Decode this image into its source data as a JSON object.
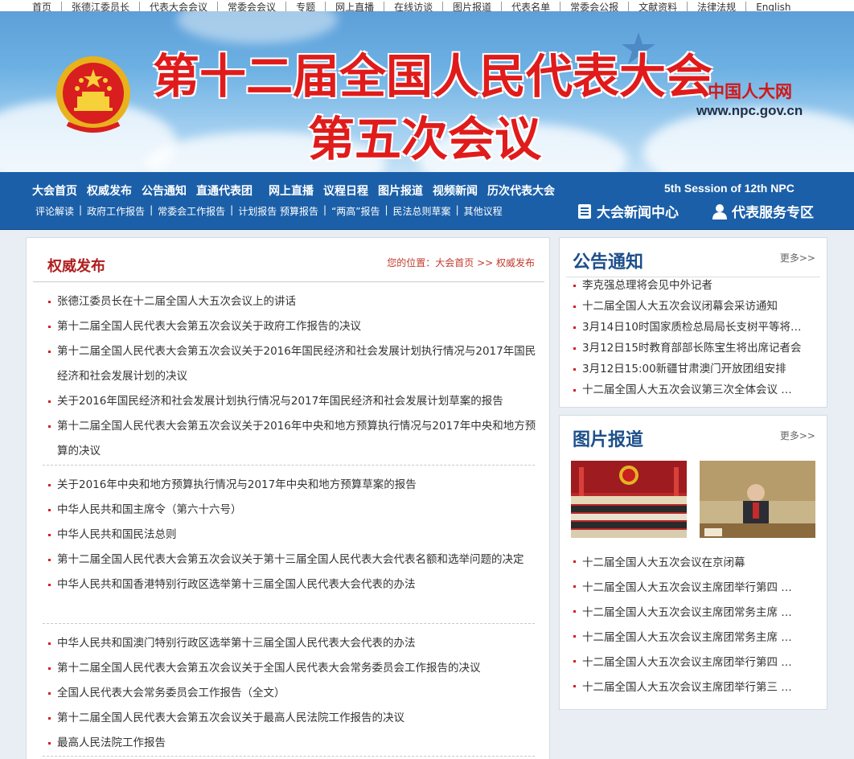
{
  "topnav": [
    "首页",
    "张德江委员长",
    "代表大会会议",
    "常委会会议",
    "专题",
    "网上直播",
    "在线访谈",
    "图片报道",
    "代表名单",
    "常委会公报",
    "文献资料",
    "法律法规",
    "English"
  ],
  "banner": {
    "title_line1": "第十二届全国人民代表大会",
    "title_line2": "第五次会议",
    "site_name": "中国人大网",
    "site_url": "www.npc.gov.cn"
  },
  "mainnav": [
    "大会首页",
    "权威发布",
    "公告通知",
    "直通代表团",
    "网上直播",
    "议程日程",
    "图片报道",
    "视频新闻",
    "历次代表大会"
  ],
  "subnav": [
    "评论解读",
    "政府工作报告",
    "常委会工作报告",
    "计划报告 预算报告",
    "“两高”报告",
    "民法总则草案",
    "其他议程"
  ],
  "session_en": "5th Session of 12th NPC",
  "services": {
    "news_center": "大会新闻中心",
    "deputy_service": "代表服务专区"
  },
  "left_panel": {
    "title": "权威发布",
    "breadcrumb": "您的位置：大会首页 >> 权威发布",
    "groups": [
      [
        "张德江委员长在十二届全国人大五次会议上的讲话",
        "第十二届全国人民代表大会第五次会议关于政府工作报告的决议",
        "第十二届全国人民代表大会第五次会议关于2016年国民经济和社会发展计划执行情况与2017年国民经济和社会发展计划的决议",
        "关于2016年国民经济和社会发展计划执行情况与2017年国民经济和社会发展计划草案的报告",
        "第十二届全国人民代表大会第五次会议关于2016年中央和地方预算执行情况与2017年中央和地方预算的决议"
      ],
      [
        "关于2016年中央和地方预算执行情况与2017年中央和地方预算草案的报告",
        "中华人民共和国主席令（第六十六号）",
        "中华人民共和国民法总则",
        "第十二届全国人民代表大会第五次会议关于第十三届全国人民代表大会代表名额和选举问题的决定",
        "中华人民共和国香港特别行政区选举第十三届全国人民代表大会代表的办法"
      ],
      [
        "中华人民共和国澳门特别行政区选举第十三届全国人民代表大会代表的办法",
        "第十二届全国人民代表大会第五次会议关于全国人民代表大会常务委员会工作报告的决议",
        "全国人民代表大会常务委员会工作报告（全文）",
        "第十二届全国人民代表大会第五次会议关于最高人民法院工作报告的决议",
        "最高人民法院工作报告"
      ]
    ]
  },
  "notice_panel": {
    "title": "公告通知",
    "more": "更多>>",
    "items": [
      "李克强总理将会见中外记者",
      "十二届全国人大五次会议闭幕会采访通知",
      "3月14日10时国家质检总局局长支树平等将…",
      "3月12日15时教育部部长陈宝生将出席记者会",
      "3月12日15:00新疆甘肃澳门开放团组安排",
      "十二届全国人大五次会议第三次全体会议 …"
    ]
  },
  "photo_panel": {
    "title": "图片报道",
    "more": "更多>>",
    "items": [
      "十二届全国人大五次会议在京闭幕",
      "十二届全国人大五次会议主席团举行第四 …",
      "十二届全国人大五次会议主席团常务主席 …",
      "十二届全国人大五次会议主席团常务主席 …",
      "十二届全国人大五次会议主席团举行第四 …",
      "十二届全国人大五次会议主席团举行第三 …"
    ]
  },
  "colors": {
    "brand_red": "#e01b1b",
    "nav_blue": "#1b5fa8",
    "title_blue": "#1d4f8a"
  }
}
